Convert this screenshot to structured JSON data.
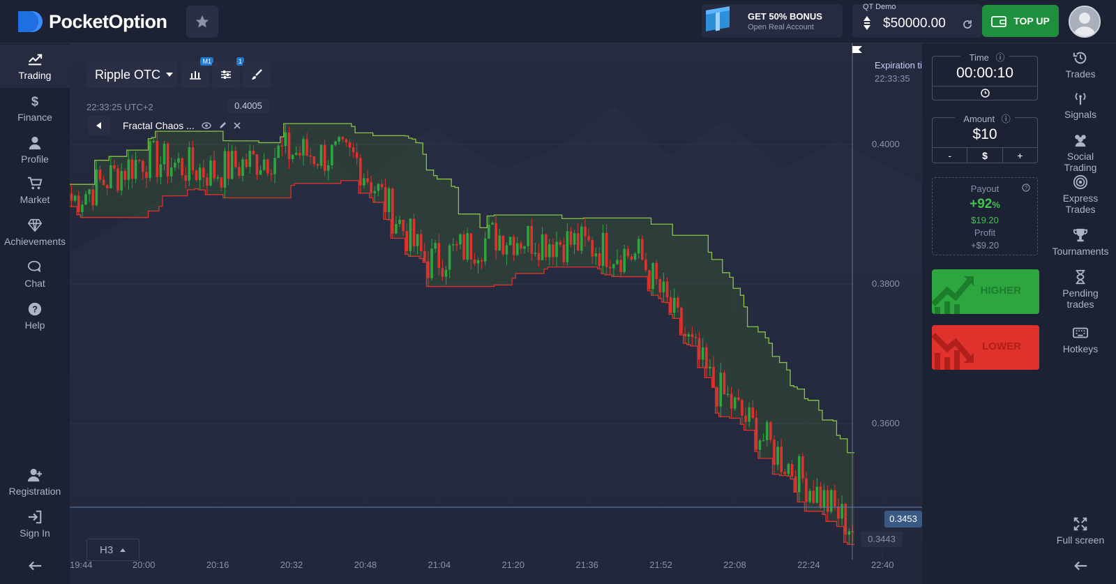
{
  "brand": {
    "name": "PocketOption"
  },
  "header": {
    "bonus_title": "GET 50% BONUS",
    "bonus_sub": "Open Real Account",
    "account_label": "QT Demo",
    "balance": "$50000.00",
    "topup_label": "TOP UP"
  },
  "left_nav": [
    {
      "label": "Trading",
      "icon": "chart-line-icon"
    },
    {
      "label": "Finance",
      "icon": "dollar-icon"
    },
    {
      "label": "Profile",
      "icon": "user-icon"
    },
    {
      "label": "Market",
      "icon": "cart-icon"
    },
    {
      "label": "Achievements",
      "icon": "diamond-icon"
    },
    {
      "label": "Chat",
      "icon": "chat-icon"
    },
    {
      "label": "Help",
      "icon": "question-icon"
    },
    {
      "label": "Registration",
      "icon": "user-plus-icon"
    },
    {
      "label": "Sign In",
      "icon": "sign-in-icon"
    }
  ],
  "toolbar": {
    "asset": "Ripple OTC",
    "badge_m1": "M1",
    "badge_1": "1",
    "time_utc": "22:33:25 UTC+2",
    "cursor_price": "0.4005",
    "indicator": "Fractal Chaos ...",
    "timeframe": "H3"
  },
  "chart_overlay": {
    "expiration_label": "Expiration ti",
    "expiration_time": "22:33:35",
    "current_price": "0.3453",
    "low_price": "0.3443"
  },
  "chart_data": {
    "type": "line",
    "x": [
      "19:44",
      "20:00",
      "20:16",
      "20:32",
      "20:48",
      "21:04",
      "21:20",
      "21:36",
      "21:52",
      "22:08",
      "22:24",
      "22:40"
    ],
    "y_ticks": [
      "0.4000",
      "0.3800",
      "0.3600"
    ],
    "ylim": [
      0.3425,
      0.4065
    ],
    "series": [
      {
        "values": [
          0.392,
          0.398,
          0.396,
          0.399,
          0.398,
          0.383,
          0.387,
          0.386,
          0.384,
          0.366,
          0.355,
          0.345
        ]
      }
    ]
  },
  "trade_panel": {
    "time_label": "Time",
    "time_value": "00:00:10",
    "amount_label": "Amount",
    "amount_value": "$10",
    "minus": "-",
    "currency": "$",
    "plus": "+",
    "payout_label": "Payout",
    "payout_percent": "+92",
    "payout_percent_sign": "%",
    "payout_amount": "$19.20",
    "profit_label": "Profit",
    "profit_value": "+$9.20",
    "higher_label": "HIGHER",
    "lower_label": "LOWER"
  },
  "right_nav": [
    {
      "label": "Trades",
      "icon": "history-icon"
    },
    {
      "label": "Signals",
      "icon": "signal-icon"
    },
    {
      "label": "Social Trading",
      "icon": "users-icon"
    },
    {
      "label": "Express Trades",
      "icon": "target-icon"
    },
    {
      "label": "Tournaments",
      "icon": "trophy-icon"
    },
    {
      "label": "Pending trades",
      "icon": "hourglass-icon"
    },
    {
      "label": "Hotkeys",
      "icon": "keyboard-icon"
    },
    {
      "label": "Full screen",
      "icon": "fullscreen-icon"
    }
  ],
  "colors": {
    "up": "#2ea63f",
    "down": "#e0322d",
    "band_upper": "#8bc34a",
    "band_lower": "#e0322d",
    "accent": "#1d7bd6"
  }
}
